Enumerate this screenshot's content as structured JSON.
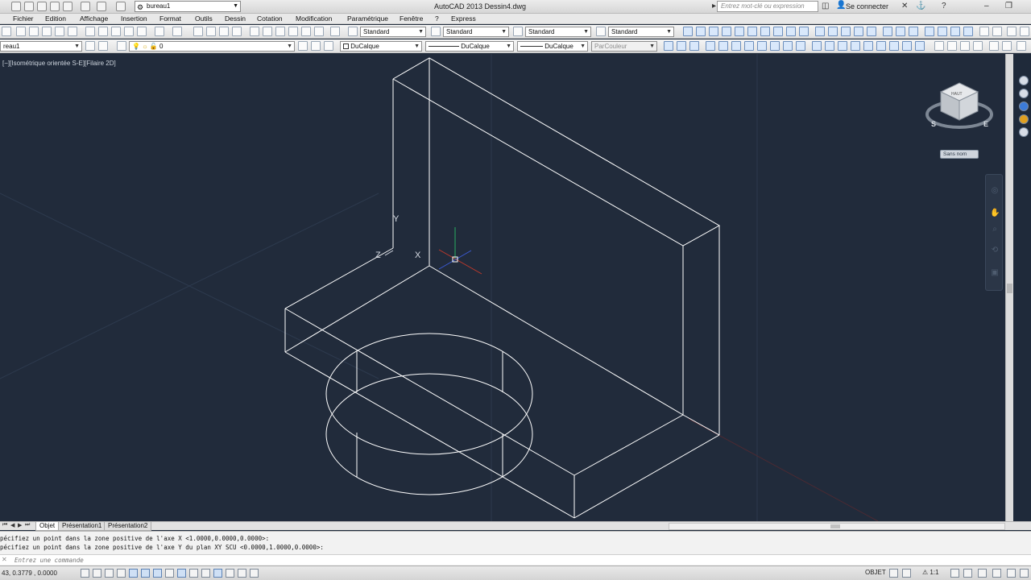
{
  "title_bar": {
    "workspace": "bureau1",
    "app_title": "AutoCAD 2013    Dessin4.dwg",
    "search_placeholder": "Entrez mot-clé ou expression",
    "sign_in": "Se connecter"
  },
  "menu": [
    "Fichier",
    "Edition",
    "Affichage",
    "Insertion",
    "Format",
    "Outils",
    "Dessin",
    "Cotation",
    "Modification",
    "Paramétrique",
    "Fenêtre",
    "?",
    "Express"
  ],
  "toolbar1": {
    "text_style": "Standard",
    "dim_style": "Standard",
    "table_style": "Standard",
    "mleader_style": "Standard"
  },
  "toolbar2": {
    "workspace_combo": "reau1",
    "layer_combo": "0",
    "color_combo": "DuCalque",
    "linetype_combo": "DuCalque",
    "lineweight_combo": "DuCalque",
    "plotstyle_combo": "ParCouleur"
  },
  "viewport": {
    "label": "[−][Isométrique orientée S-E][Filaire 2D]",
    "ucs_labels": {
      "x": "X",
      "y": "Y",
      "z": "Z"
    },
    "viewcube": {
      "face": "HAUT",
      "compass_s": "S",
      "compass_e": "E"
    },
    "ucs_name": "Sans nom"
  },
  "tabs": [
    "Objet",
    "Présentation1",
    "Présentation2"
  ],
  "active_tab": "Objet",
  "command": {
    "history": [
      "pécifiez un point dans la zone positive de l'axe X <1.0000,0.0000,0.0000>:",
      "pécifiez un point dans la zone positive de l'axe Y du plan XY SCU <0.0000,1.0000,0.0000>:"
    ],
    "input_placeholder": "Entrez une commande"
  },
  "status_bar": {
    "coords": "43, 0.3779 , 0.0000",
    "model_button": "OBJET",
    "annotation_scale": "1:1"
  },
  "colors": {
    "viewport_bg": "#212b3b",
    "geometry": "#ffffff",
    "crosshair_x": "#c0392b",
    "crosshair_y": "#27ae60",
    "crosshair_z": "#3b5bd6"
  }
}
